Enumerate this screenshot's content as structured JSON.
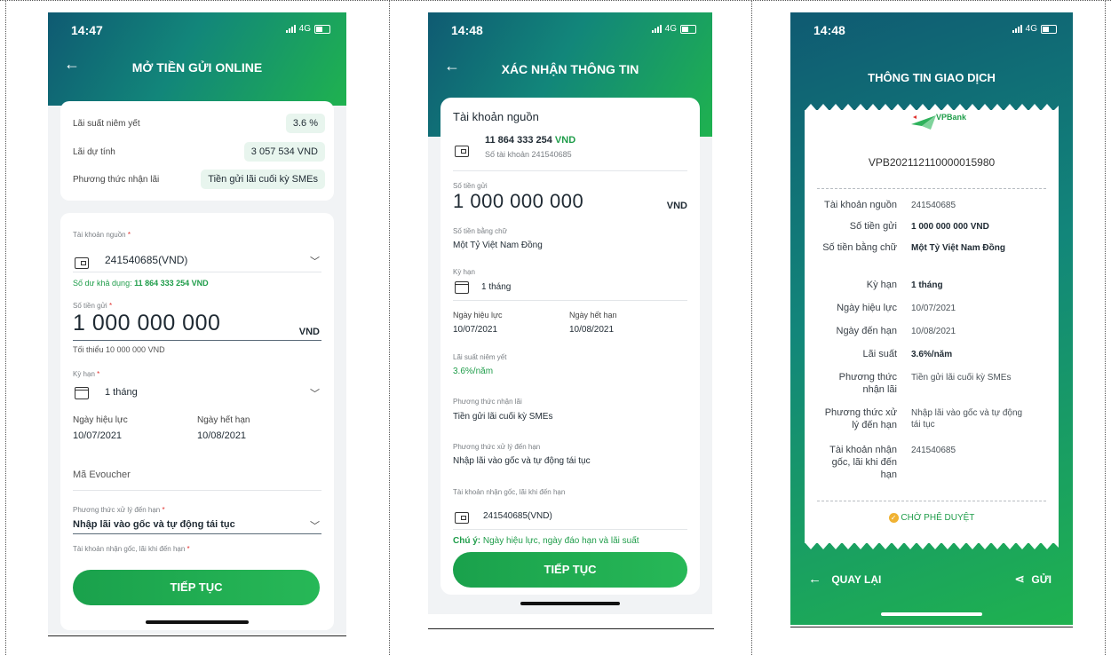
{
  "screen1": {
    "time": "14:47",
    "network": "4G",
    "title": "MỞ TIỀN GỬI ONLINE",
    "summary": [
      {
        "label": "Lãi suất niêm yết",
        "value": "3.6 %"
      },
      {
        "label": "Lãi dự tính",
        "value": "3 057 534  VND"
      },
      {
        "label": "Phương thức nhận lãi",
        "value": "Tiền gửi lãi cuối kỳ SMEs"
      }
    ],
    "source_label": "Tài khoản nguồn",
    "source_value": "241540685(VND)",
    "balance_text": "Số dư khả dụng:",
    "balance_value": "11 864 333 254 VND",
    "amount_label": "Số tiền gửi",
    "amount_value": "1 000 000 000",
    "currency": "VND",
    "min_text": "Tối thiểu 10 000 000 VND",
    "term_label": "Kỳ hạn",
    "term_value": "1 tháng",
    "effective_label": "Ngày hiệu lực",
    "effective_value": "10/07/2021",
    "expiry_label": "Ngày hết hạn",
    "expiry_value": "10/08/2021",
    "evoucher_placeholder": "Mã Evoucher",
    "maturity_label": "Phương thức xử lý đến hạn",
    "maturity_value": "Nhập lãi vào gốc và tự động tái tục",
    "receive_label": "Tài khoản nhận gốc, lãi khi đến hạn",
    "required_mark": "*",
    "button": "TIẾP TỤC"
  },
  "screen2": {
    "time": "14:48",
    "network": "4G",
    "title": "XÁC NHẬN THÔNG TIN",
    "source_heading": "Tài khoản nguồn",
    "balance": "11 864 333 254",
    "balance_currency": "VND",
    "account_text": "Số tài khoản 241540685",
    "amount_label": "Số tiền gửi",
    "amount_value": "1 000 000 000",
    "currency": "VND",
    "words_label": "Số tiền bằng chữ",
    "words_value": "Một Tỷ Việt Nam Đồng",
    "term_label": "Kỳ hạn",
    "term_value": "1 tháng",
    "effective_label": "Ngày hiệu lực",
    "effective_value": "10/07/2021",
    "expiry_label": "Ngày hết hạn",
    "expiry_value": "10/08/2021",
    "rate_label": "Lãi suất niêm yết",
    "rate_value": "3.6%/năm",
    "receive_method_label": "Phương thức nhận lãi",
    "receive_method_value": "Tiền gửi lãi cuối kỳ SMEs",
    "maturity_label": "Phương thức xử lý đến hạn",
    "maturity_value": "Nhập lãi vào gốc và tự động tái tục",
    "receive_account_label": "Tài khoản nhận gốc, lãi khi đến hạn",
    "receive_account_value": "241540685(VND)",
    "note_prefix": "Chú ý:",
    "note_text": "Ngày hiệu lực, ngày đáo hạn và lãi suất",
    "button": "TIẾP TỤC"
  },
  "screen3": {
    "time": "14:48",
    "network": "4G",
    "title": "THÔNG TIN GIAO DỊCH",
    "logo_text": "VPBank",
    "reference": "VPB202112110000015980",
    "rows": [
      {
        "label": "Tài khoản nguồn",
        "value": "241540685",
        "bold": false
      },
      {
        "label": "Số tiền gửi",
        "value": "1 000 000 000 VND",
        "bold": true
      },
      {
        "label": "Số tiền bằng chữ",
        "value": "Một Tỷ Việt Nam Đồng",
        "bold": true
      },
      {
        "label": "Kỳ hạn",
        "value": "1 tháng",
        "bold": true
      },
      {
        "label": "Ngày hiệu lực",
        "value": "10/07/2021",
        "bold": false
      },
      {
        "label": "Ngày đến hạn",
        "value": "10/08/2021",
        "bold": false
      },
      {
        "label": "Lãi suất",
        "value": "3.6%/năm",
        "bold": true
      },
      {
        "label": "Phương thức nhận lãi",
        "value": "Tiền gửi lãi cuối kỳ SMEs",
        "bold": false
      },
      {
        "label": "Phương thức xử lý đến hạn",
        "value": "Nhập lãi vào gốc và tự động tái tục",
        "bold": false
      },
      {
        "label": "Tài khoản nhận gốc, lãi khi đến hạn",
        "value": "241540685",
        "bold": false
      }
    ],
    "status": "CHỜ PHÊ DUYỆT",
    "back": "QUAY LẠI",
    "send": "GỬI"
  }
}
